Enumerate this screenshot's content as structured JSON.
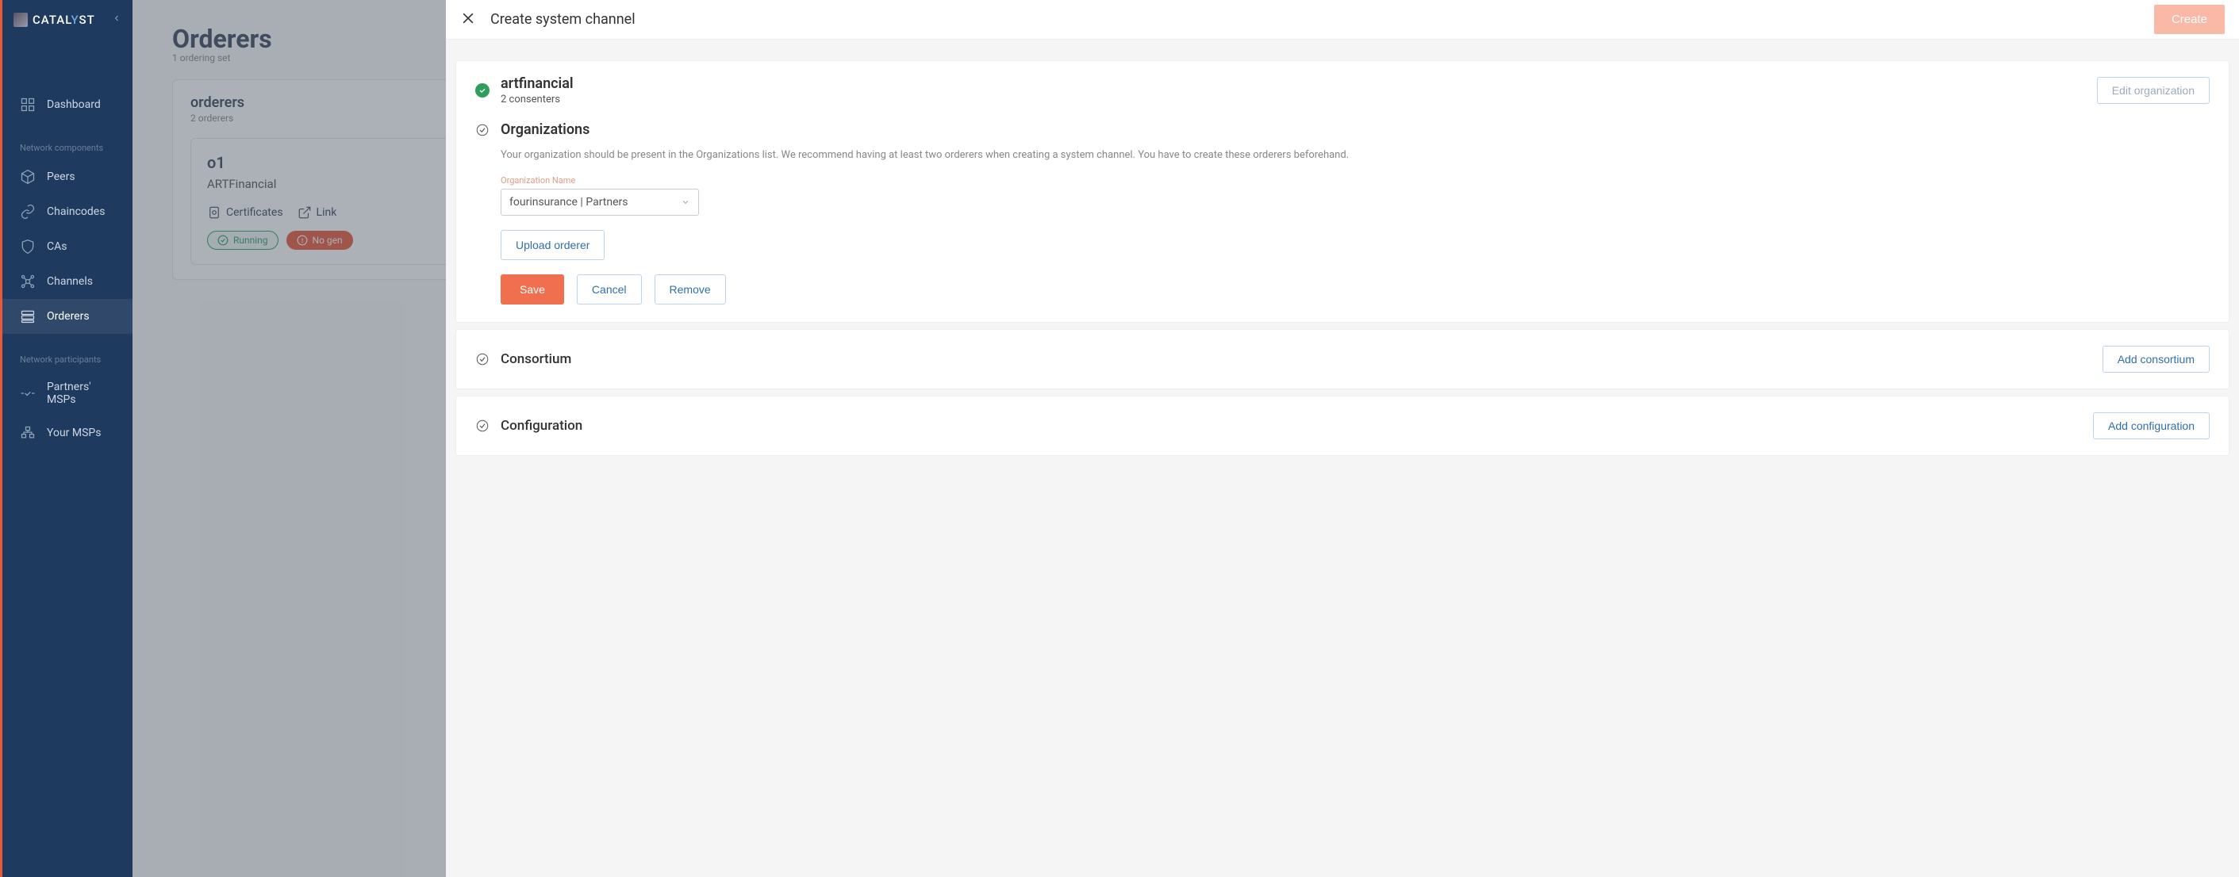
{
  "app": {
    "name_a": "CATAL",
    "name_y": "Y",
    "name_b": "ST"
  },
  "sidebar": {
    "items": [
      {
        "label": "Dashboard"
      },
      {
        "label": "Peers"
      },
      {
        "label": "Chaincodes"
      },
      {
        "label": "CAs"
      },
      {
        "label": "Channels"
      },
      {
        "label": "Orderers"
      },
      {
        "label": "Partners' MSPs"
      },
      {
        "label": "Your MSPs"
      }
    ],
    "section_components": "Network components",
    "section_participants": "Network participants"
  },
  "page": {
    "title": "Orderers",
    "subtitle": "1 ordering set",
    "set_name": "orderers",
    "set_count": "2 orderers",
    "node": {
      "name": "o1",
      "org": "ARTFinancial",
      "cert_link": "Certificates",
      "ext_link": "Link",
      "status_running": "Running",
      "status_error": "No gen"
    }
  },
  "panel": {
    "title": "Create system channel",
    "create_btn": "Create",
    "org": {
      "name": "artfinancial",
      "consenters": "2 consenters",
      "edit_btn": "Edit organization"
    },
    "organizations": {
      "title": "Organizations",
      "help": "Your organization should be present in the Organizations list. We recommend having at least two orderers when creating a system channel. You have to create these orderers beforehand.",
      "field_label": "Organization Name",
      "selected": "fourinsurance | Partners",
      "upload_btn": "Upload orderer",
      "save_btn": "Save",
      "cancel_btn": "Cancel",
      "remove_btn": "Remove"
    },
    "consortium": {
      "title": "Consortium",
      "add_btn": "Add consortium"
    },
    "configuration": {
      "title": "Configuration",
      "add_btn": "Add configuration"
    }
  }
}
